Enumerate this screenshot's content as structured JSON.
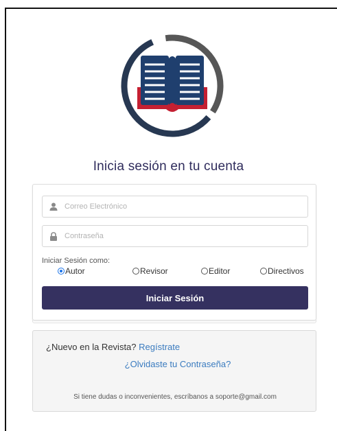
{
  "login": {
    "title": "Inicia sesión en tu cuenta",
    "email_placeholder": "Correo Electrónico",
    "password_placeholder": "Contraseña",
    "role_label": "Iniciar Sesión como:",
    "roles": [
      {
        "label": "Autor",
        "selected": true
      },
      {
        "label": "Revisor",
        "selected": false
      },
      {
        "label": "Editor",
        "selected": false
      },
      {
        "label": "Directivos",
        "selected": false
      }
    ],
    "submit_label": "Iniciar Sesión"
  },
  "footer": {
    "new_prompt": "¿Nuevo en la Revista?",
    "register_link": "Regístrate",
    "forgot_link": "¿Olvidaste tu Contraseña?",
    "support_text": "Si tiene dudas o inconvenientes, escríbanos a soporte@gmail.com"
  },
  "icons": {
    "logo": "open-book-logo-icon",
    "email": "user-icon",
    "password": "lock-icon"
  },
  "colors": {
    "primary": "#353160",
    "logo_ring": "#2e3b55",
    "logo_gray": "#5a5a5a",
    "logo_book": "#1f3f6e",
    "logo_red": "#c42032",
    "link": "#3a7bbf"
  }
}
